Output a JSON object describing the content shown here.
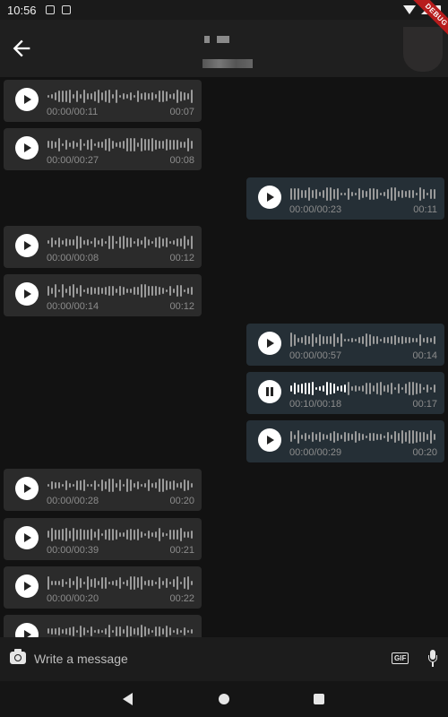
{
  "status_bar": {
    "time": "10:56",
    "debug_label": "DEBUG"
  },
  "app_bar": {
    "back_icon": "arrow-back-icon",
    "title": "",
    "subtitle": ""
  },
  "colors": {
    "incoming_bubble": "#2b2b2b",
    "outgoing_bubble": "#252f36",
    "waveform": "#9a9a9a",
    "played_waveform": "#ffffff"
  },
  "messages": [
    {
      "direction": "in",
      "state": "play",
      "progress": "00:00/00:11",
      "duration": "00:07"
    },
    {
      "direction": "in",
      "state": "play",
      "progress": "00:00/00:27",
      "duration": "00:08"
    },
    {
      "direction": "out",
      "state": "play",
      "progress": "00:00/00:23",
      "duration": "00:11"
    },
    {
      "direction": "in",
      "state": "play",
      "progress": "00:00/00:08",
      "duration": "00:12"
    },
    {
      "direction": "in",
      "state": "play",
      "progress": "00:00/00:14",
      "duration": "00:12"
    },
    {
      "direction": "out",
      "state": "play",
      "progress": "00:00/00:57",
      "duration": "00:14"
    },
    {
      "direction": "out",
      "state": "pause",
      "progress": "00:10/00:18",
      "duration": "00:17"
    },
    {
      "direction": "out",
      "state": "play",
      "progress": "00:00/00:29",
      "duration": "00:20"
    },
    {
      "direction": "in",
      "state": "play",
      "progress": "00:00/00:28",
      "duration": "00:20"
    },
    {
      "direction": "in",
      "state": "play",
      "progress": "00:00/00:39",
      "duration": "00:21"
    },
    {
      "direction": "in",
      "state": "play",
      "progress": "00:00/00:20",
      "duration": "00:22"
    },
    {
      "direction": "in",
      "state": "play",
      "progress": "",
      "duration": ""
    }
  ],
  "composer": {
    "placeholder": "Write a message",
    "gif_label": "GIF",
    "camera_icon": "camera-icon",
    "mic_icon": "mic-icon"
  },
  "nav_bar": {
    "back": "nav-back-icon",
    "home": "nav-home-icon",
    "recents": "nav-recents-icon"
  }
}
